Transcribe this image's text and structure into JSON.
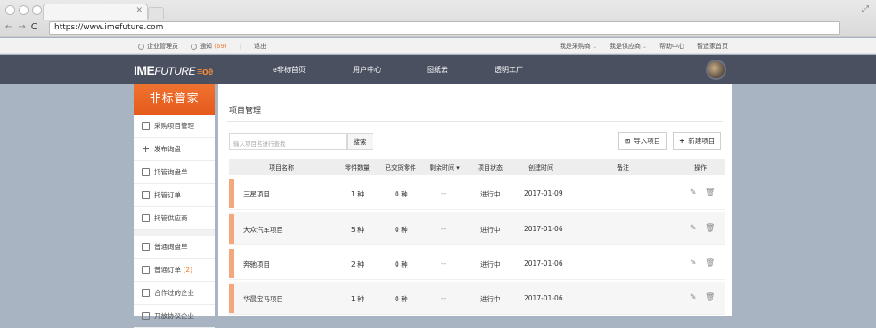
{
  "browser": {
    "url": "https://www.imefuture.com"
  },
  "topbar": {
    "left": {
      "user": "企业管理员",
      "notice": "通知",
      "notice_count": "(69)",
      "logout": "退出"
    },
    "right": {
      "buyer": "我是采购商",
      "supplier": "我是供应商",
      "help": "帮助中心",
      "home": "智造家首页"
    }
  },
  "header": {
    "logo_main": "IME",
    "logo_sub": "FUTURE",
    "logo_mark": "≡oē",
    "nav": [
      "e非标首页",
      "用户中心",
      "图纸云",
      "透明工厂"
    ]
  },
  "sidebar": {
    "banner": "非标管家",
    "group1": [
      "采购项目管理",
      "发布询盘",
      "托管询盘单",
      "托管订单",
      "托管供应商"
    ],
    "group2": [
      "普通询盘单",
      "普通订单",
      "合作过的企业",
      "开放协议企业"
    ],
    "order_count": "(2)"
  },
  "main": {
    "title": "项目管理",
    "search_placeholder": "输入项目名进行查找",
    "search_btn": "搜索",
    "import_btn": "导入项目",
    "new_btn": "新建项目",
    "columns": [
      "项目名称",
      "零件数量",
      "已交货零件",
      "剩余时间",
      "项目状态",
      "创建时间",
      "备注",
      "操作"
    ],
    "rows": [
      {
        "name": "三星项目",
        "parts": "1 种",
        "delivered": "0 种",
        "remaining": "--",
        "status": "进行中",
        "created": "2017-01-09"
      },
      {
        "name": "大众汽车项目",
        "parts": "5 种",
        "delivered": "0 种",
        "remaining": "--",
        "status": "进行中",
        "created": "2017-01-06"
      },
      {
        "name": "奔驰项目",
        "parts": "2 种",
        "delivered": "0 种",
        "remaining": "--",
        "status": "进行中",
        "created": "2017-01-06"
      },
      {
        "name": "华晨宝马项目",
        "parts": "1 种",
        "delivered": "0 种",
        "remaining": "--",
        "status": "进行中",
        "created": "2017-01-06"
      }
    ]
  }
}
